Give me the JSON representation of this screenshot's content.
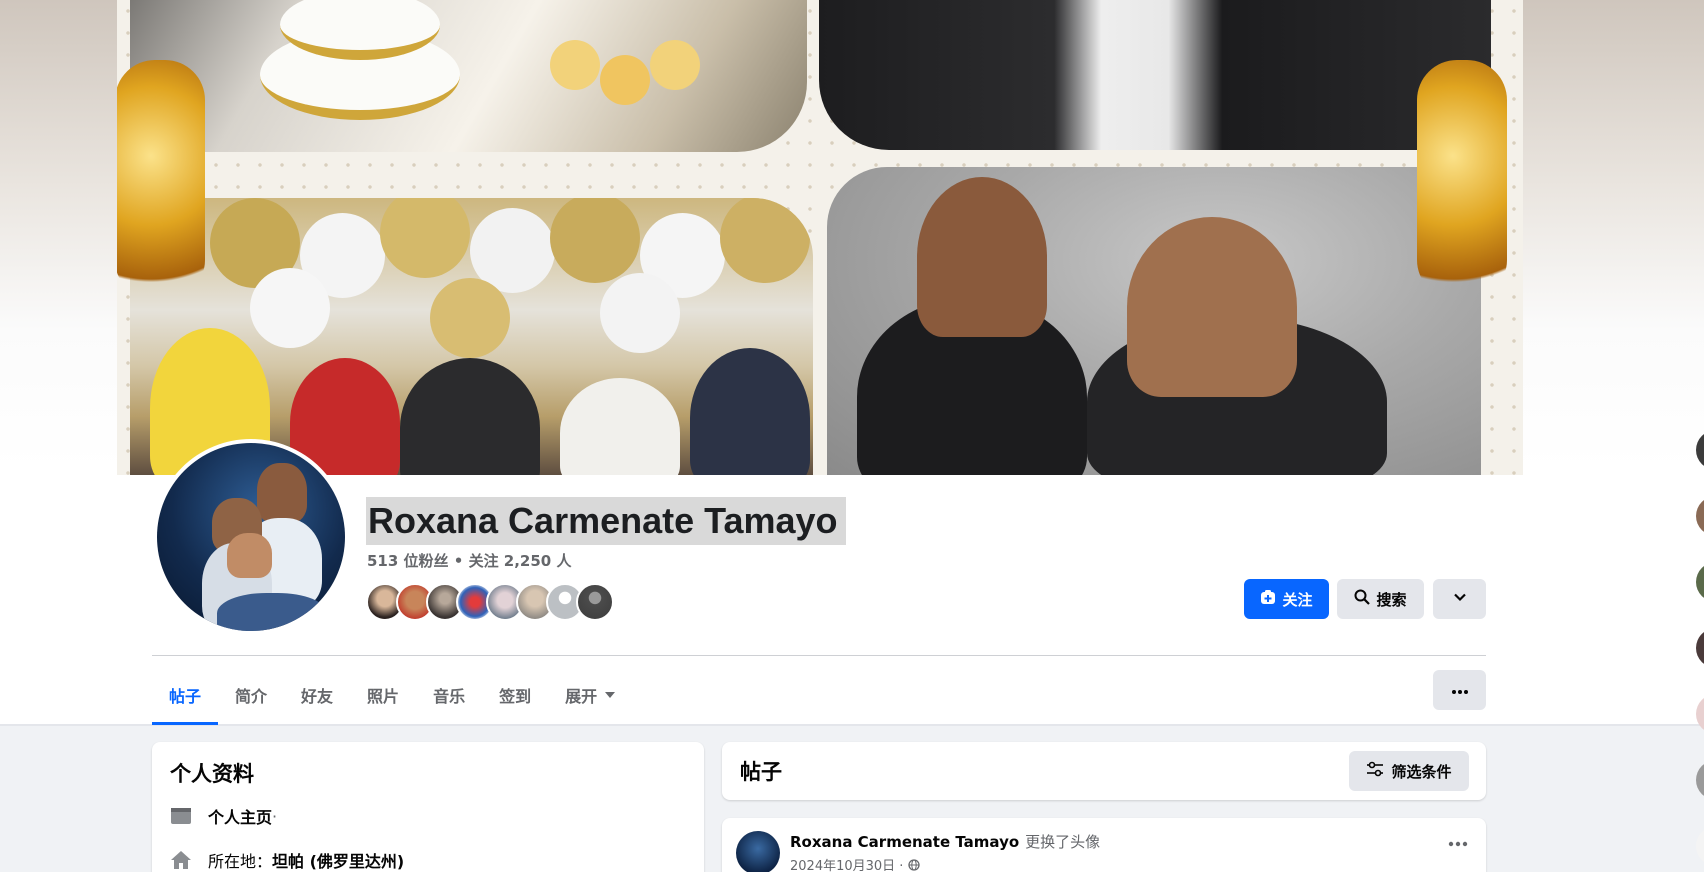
{
  "profile": {
    "name": "Roxana Carmenate Tamayo",
    "stats": "513 位粉丝 • 关注 2,250 人"
  },
  "actions": {
    "follow_label": "关注",
    "search_label": "搜索"
  },
  "tabs": [
    {
      "label": "帖子",
      "active": true
    },
    {
      "label": "简介"
    },
    {
      "label": "好友"
    },
    {
      "label": "照片"
    },
    {
      "label": "音乐"
    },
    {
      "label": "签到"
    },
    {
      "label": "展开"
    }
  ],
  "intro": {
    "title": "个人资料",
    "rows": [
      {
        "icon": "flag-icon",
        "label": "个人主页",
        "suffix": " ·"
      },
      {
        "icon": "home-icon",
        "prefix": "所在地：",
        "value": "坦帕 (佛罗里达州)"
      }
    ]
  },
  "posts": {
    "title": "帖子",
    "filter_label": "筛选条件",
    "first": {
      "author": "Roxana Carmenate Tamayo",
      "action": "更换了头像",
      "date": "2024年10月30日 ·"
    }
  },
  "icons": {
    "follow": "add-user-icon",
    "search": "search-icon",
    "more": "chevron-down-icon",
    "tab_more": "more-horizontal-icon",
    "filter": "sliders-icon",
    "globe": "globe-icon"
  },
  "colors": {
    "accent": "#0866ff",
    "secondary_button": "#e4e6eb",
    "page_bg": "#f0f2f5"
  }
}
